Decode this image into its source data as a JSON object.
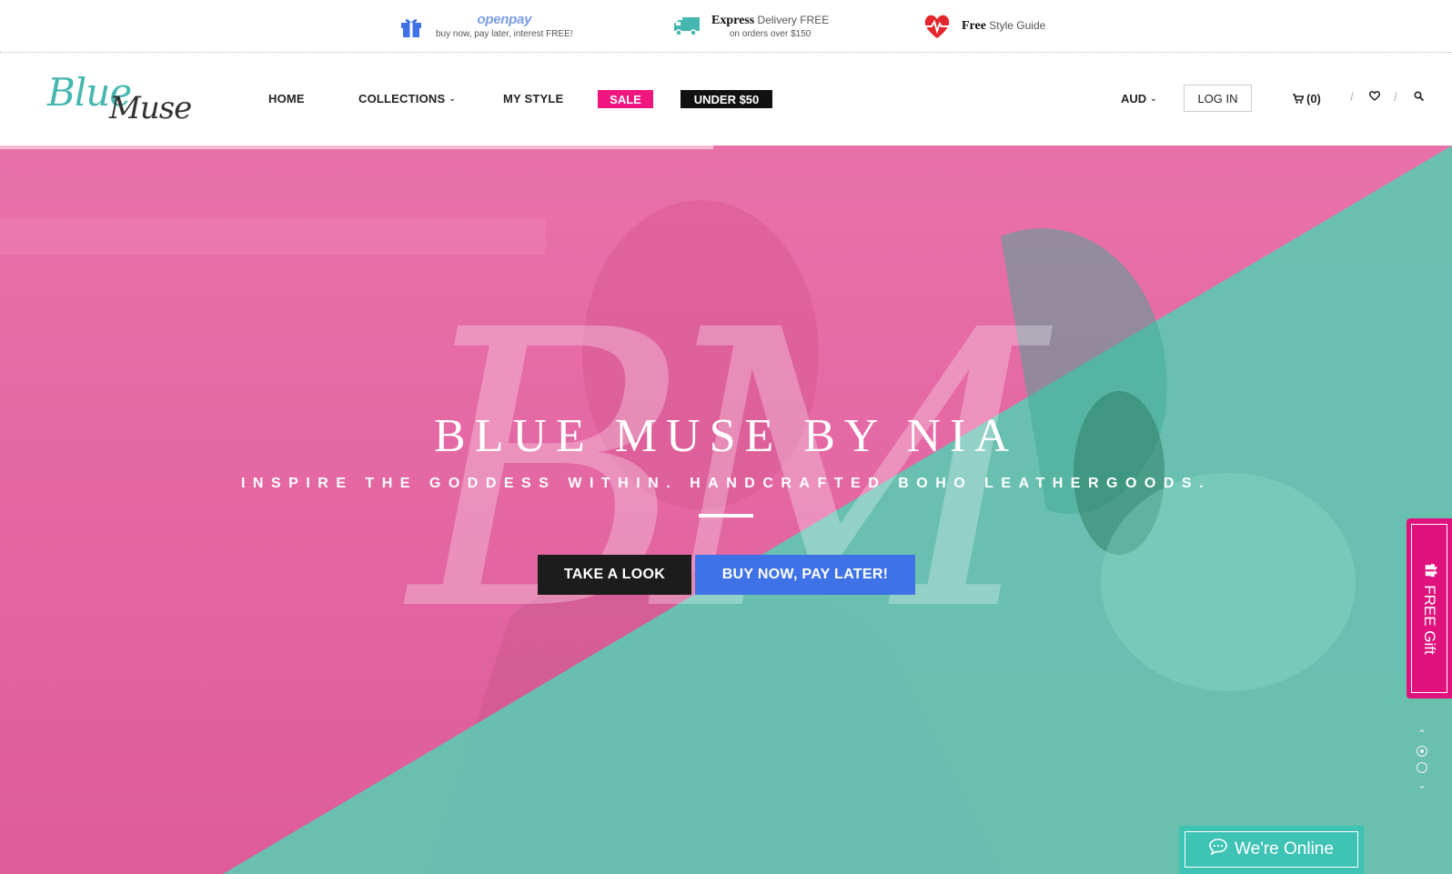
{
  "promo": {
    "openpay": {
      "logo": "openpay",
      "sub": "buy now, pay later, interest FREE!",
      "icon": "gift-icon"
    },
    "express": {
      "bold": "Express",
      "rest": " Delivery FREE",
      "sub": "on orders over $150",
      "icon": "truck-icon"
    },
    "style": {
      "bold": "Free",
      "rest": " Style Guide",
      "icon": "heartbeat-icon"
    }
  },
  "header": {
    "logo_line1": "Blue",
    "logo_line2": "Muse",
    "nav": {
      "home": "HOME",
      "collections": "COLLECTIONS",
      "my_style": "MY STYLE",
      "sale": "SALE",
      "under50": "UNDER $50"
    },
    "currency": "AUD",
    "login": "LOG IN",
    "cart": "(0)",
    "slash": "/"
  },
  "hero": {
    "watermark": "BM",
    "title": "BLUE MUSE BY NIA",
    "subtitle": "INSPIRE THE GODDESS WITHIN. HANDCRAFTED BOHO LEATHERGOODS.",
    "btn_look": "TAKE A LOOK",
    "btn_pay": "BUY NOW, PAY LATER!"
  },
  "side": {
    "gift": "FREE Gift"
  },
  "chat": {
    "label": "We're Online"
  },
  "colors": {
    "pink": "#e0137e",
    "teal": "#3ec3b4",
    "blue": "#3f72e6",
    "sale": "#f0157f"
  }
}
